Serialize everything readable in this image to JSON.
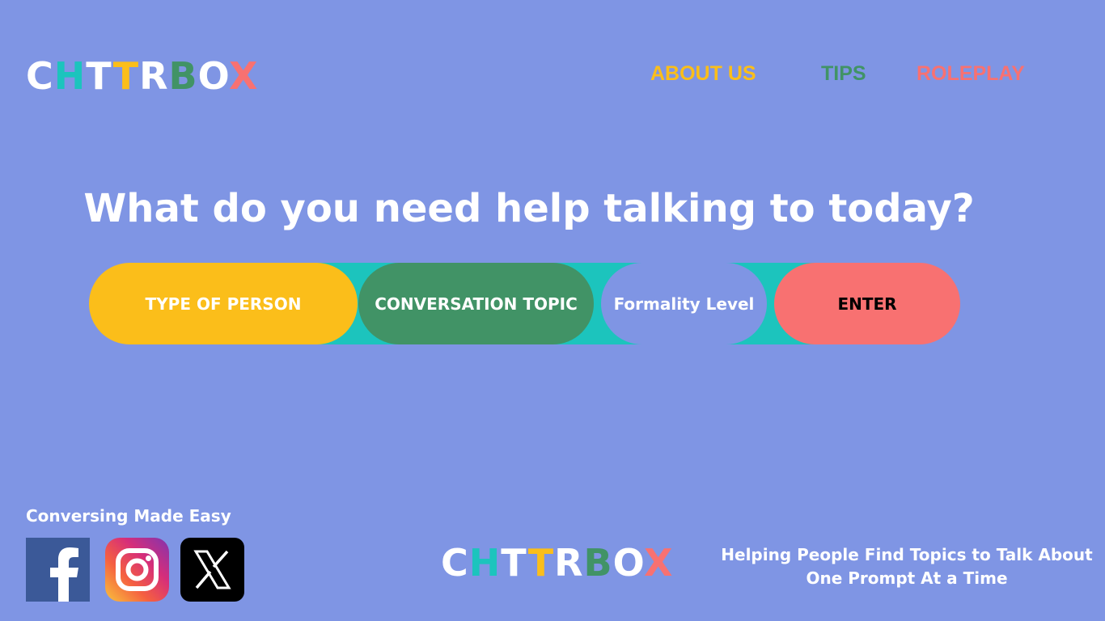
{
  "brand": {
    "letters": [
      {
        "char": "C",
        "color": "#ffffff"
      },
      {
        "char": "H",
        "color": "#1cc4bd"
      },
      {
        "char": "T",
        "color": "#ffffff"
      },
      {
        "char": "T",
        "color": "#fbbe1a"
      },
      {
        "char": "R",
        "color": "#ffffff"
      },
      {
        "char": "B",
        "color": "#419366"
      },
      {
        "char": "O",
        "color": "#ffffff"
      },
      {
        "char": "X",
        "color": "#f87171"
      }
    ]
  },
  "nav": {
    "about": {
      "label": "ABOUT US",
      "color": "#fbbe1a"
    },
    "tips": {
      "label": "TIPS",
      "color": "#419366"
    },
    "roleplay": {
      "label": "ROLEPLAY",
      "color": "#f87171"
    }
  },
  "headline": "What do you need help talking to today?",
  "selectors": {
    "person": {
      "label": "TYPE OF PERSON",
      "bg": "#fbbe1a",
      "fg": "#ffffff"
    },
    "topic": {
      "label": "CONVERSATION TOPIC",
      "bg": "#419366",
      "fg": "#ffffff"
    },
    "formality": {
      "label": "Formality Level",
      "bg": "#7f95e4",
      "fg": "#ffffff"
    },
    "enter": {
      "label": "ENTER",
      "bg": "#f87171",
      "fg": "#000000"
    }
  },
  "footer": {
    "tagline": "Conversing Made Easy",
    "mission_line1": "Helping People Find Topics to Talk About",
    "mission_line2": "One Prompt At a Time",
    "social": [
      {
        "icon": "facebook-icon"
      },
      {
        "icon": "instagram-icon"
      },
      {
        "icon": "x-icon"
      }
    ]
  },
  "colors": {
    "background": "#7f95e4",
    "teal": "#1cc4bd",
    "yellow": "#fbbe1a",
    "green": "#419366",
    "coral": "#f87171"
  }
}
